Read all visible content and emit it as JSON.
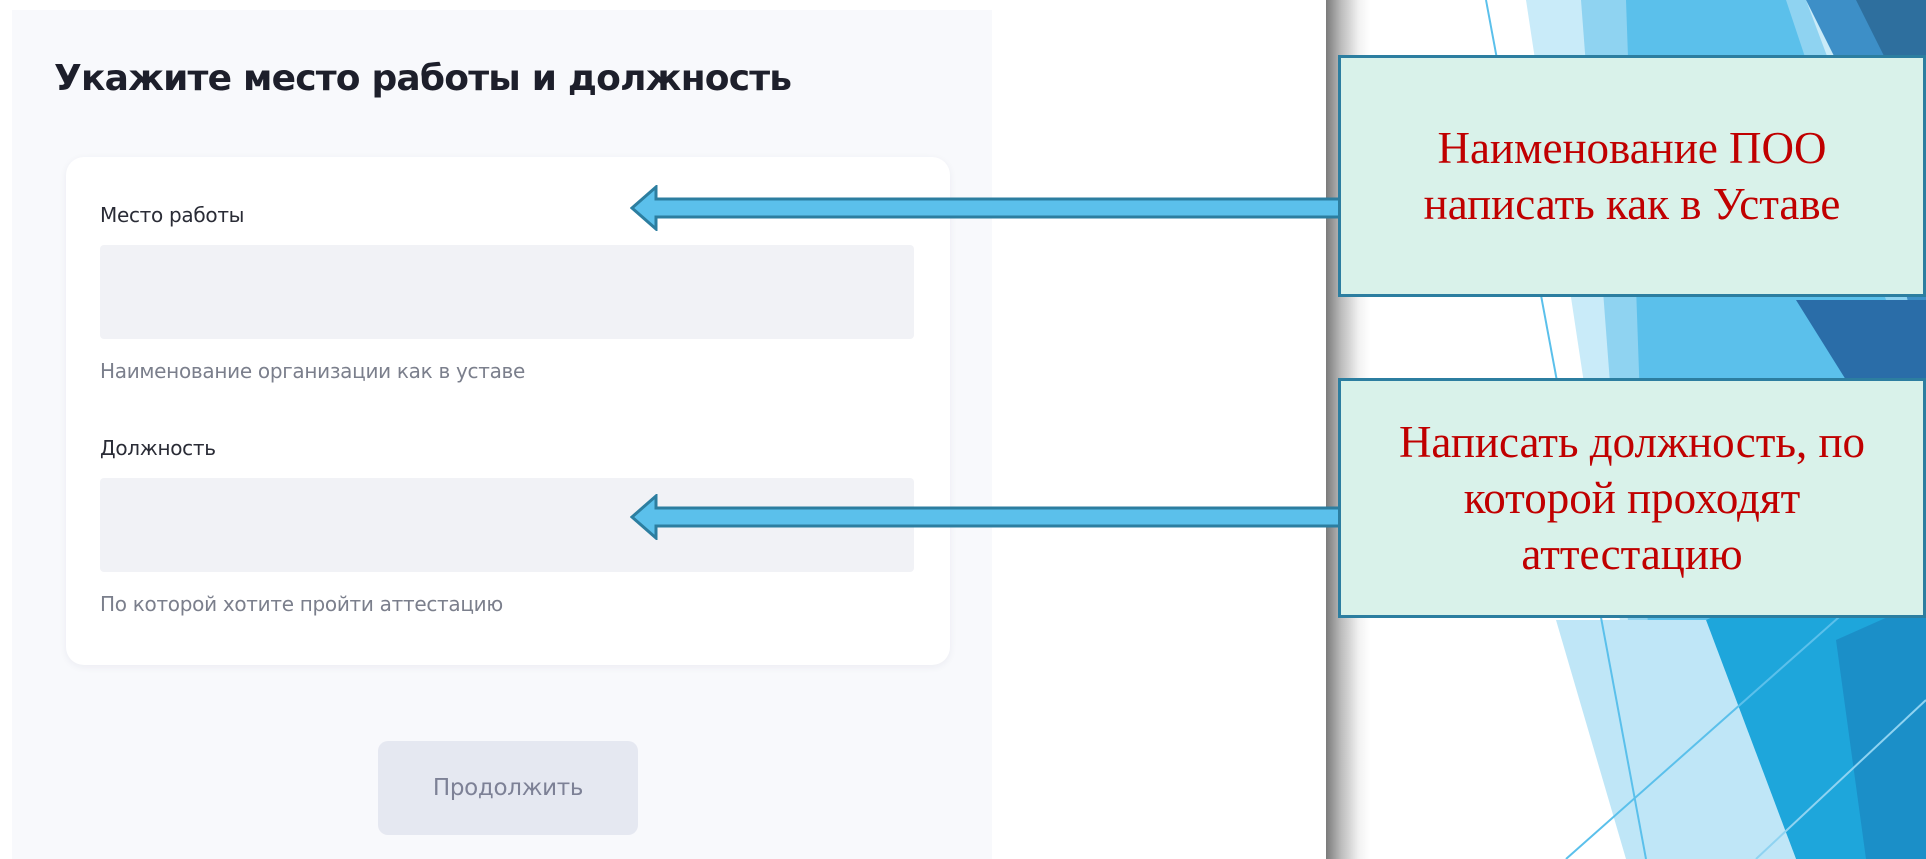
{
  "form": {
    "title": "Укажите место работы и должность",
    "workplace": {
      "label": "Место работы",
      "value": "",
      "placeholder": "",
      "hint": "Наименование организации как в уставе"
    },
    "position": {
      "label": "Должность",
      "value": "",
      "placeholder": "",
      "hint": "По которой хотите пройти аттестацию"
    },
    "continue_label": "Продолжить"
  },
  "annotations": {
    "workplace_note": "Наименование ПОО написать как в Уставе",
    "position_note": "Написать должность, по которой проходят аттестацию"
  },
  "colors": {
    "callout_fill": "#d9f2ea",
    "callout_border": "#2c7ea0",
    "callout_text": "#c00000",
    "arrow_fill": "#5bc0eb"
  }
}
